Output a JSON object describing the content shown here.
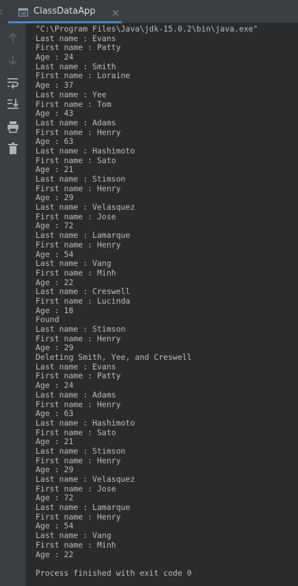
{
  "tab": {
    "left_mark": ":",
    "title": "ClassDataApp"
  },
  "colors": {
    "background": "#2b2b2b",
    "toolbar": "#3c3f41",
    "text": "#bbbbbb",
    "icon": "#6f737a",
    "tab_underline": "#4a88c7"
  },
  "toolbar": {
    "items": [
      {
        "icon": "arrow-up-icon",
        "label": "up"
      },
      {
        "icon": "arrow-down-icon",
        "label": "down"
      },
      {
        "icon": "soft-wrap-icon",
        "label": "wrap"
      },
      {
        "icon": "scroll-to-end-icon",
        "label": "scroll"
      },
      {
        "icon": "print-icon",
        "label": "print"
      },
      {
        "icon": "trash-icon",
        "label": "clear"
      }
    ]
  },
  "console": {
    "lines": [
      "\"C:\\Program Files\\Java\\jdk-15.0.2\\bin\\java.exe\"",
      "Last name : Evans",
      "First name : Patty",
      "Age : 24",
      "Last name : Smith",
      "First name : Loraine",
      "Age : 37",
      "Last name : Yee",
      "First name : Tom",
      "Age : 43",
      "Last name : Adams",
      "First name : Henry",
      "Age : 63",
      "Last name : Hashimoto",
      "First name : Sato",
      "Age : 21",
      "Last name : Stimson",
      "First name : Henry",
      "Age : 29",
      "Last name : Velasquez",
      "First name : Jose",
      "Age : 72",
      "Last name : Lamarque",
      "First name : Henry",
      "Age : 54",
      "Last name : Vang",
      "First name : Minh",
      "Age : 22",
      "Last name : Creswell",
      "First name : Lucinda",
      "Age : 18",
      "Found",
      "Last name : Stimson",
      "First name : Henry",
      "Age : 29",
      "Deleting Smith, Yee, and Creswell",
      "Last name : Evans",
      "First name : Patty",
      "Age : 24",
      "Last name : Adams",
      "First name : Henry",
      "Age : 63",
      "Last name : Hashimoto",
      "First name : Sato",
      "Age : 21",
      "Last name : Stimson",
      "First name : Henry",
      "Age : 29",
      "Last name : Velasquez",
      "First name : Jose",
      "Age : 72",
      "Last name : Lamarque",
      "First name : Henry",
      "Age : 54",
      "Last name : Vang",
      "First name : Minh",
      "Age : 22",
      "",
      "Process finished with exit code 0"
    ]
  }
}
